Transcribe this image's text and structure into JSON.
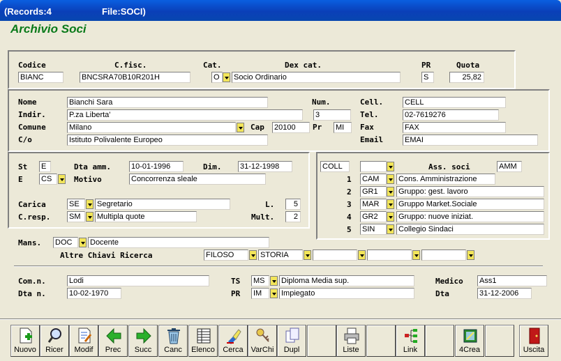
{
  "window": {
    "records": "(Records:4",
    "file": "File:SOCI)"
  },
  "app_title": "Archivio Soci",
  "labels": {
    "codice": "Codice",
    "cfisc": "C.fisc.",
    "cat": "Cat.",
    "dexcat": "Dex cat.",
    "pr": "PR",
    "quota": "Quota",
    "nome": "Nome",
    "indir": "Indir.",
    "comune": "Comune",
    "co": "C/o",
    "num": "Num.",
    "cap": "Cap",
    "pr2": "Pr",
    "cell": "Cell.",
    "tel": "Tel.",
    "fax": "Fax",
    "email": "Email",
    "st": "St",
    "dtaamm": "Dta amm.",
    "dim": "Dim.",
    "e": "E",
    "motivo": "Motivo",
    "carica": "Carica",
    "l": "L.",
    "cresp": "C.resp.",
    "mult": "Mult.",
    "asssoci": "Ass. soci",
    "mans": "Mans.",
    "altre": "Altre Chiavi Ricerca",
    "comn": "Com.n.",
    "dtan": "Dta n.",
    "ts": "TS",
    "pr3": "PR",
    "medico": "Medico",
    "dta": "Dta"
  },
  "fields": {
    "codice": "BIANC",
    "cfisc": "BNCSRA70B10R201H",
    "cat_code": "O",
    "cat_desc": "Socio Ordinario",
    "pr": "S",
    "quota": "25,82",
    "nome": "Bianchi Sara",
    "indir": "P.za Liberta'",
    "comune": "Milano",
    "co": "Istituto Polivalente Europeo",
    "num": "3",
    "cap": "20100",
    "prov": "MI",
    "cell": "CELL",
    "tel": "02-7619276",
    "fax": "FAX",
    "email": "EMAI",
    "st": "E",
    "dtaamm": "10-01-1996",
    "dim": "31-12-1998",
    "e_code": "CS",
    "motivo": "Concorrenza sleale",
    "carica_code": "SE",
    "carica_desc": "Segretario",
    "l": "5",
    "cresp_code": "SM",
    "cresp_desc": "Multipla quote",
    "mult": "2",
    "coll": "COLL",
    "ass_code": "AMM",
    "mans_code": "DOC",
    "mans_desc": "Docente",
    "chiave1": "FILOSO",
    "chiave2": "STORIA",
    "comn": "Lodi",
    "dtan": "10-02-1970",
    "ts_code": "MS",
    "ts_desc": "Diploma Media sup.",
    "pr_code": "IM",
    "pr_desc": "Impiegato",
    "medico": "Ass1",
    "dta": "31-12-2006"
  },
  "assoc": [
    {
      "n": "1",
      "code": "CAM",
      "desc": "Cons. Amministrazione"
    },
    {
      "n": "2",
      "code": "GR1",
      "desc": "Gruppo: gest. lavoro"
    },
    {
      "n": "3",
      "code": "MAR",
      "desc": "Gruppo Market.Sociale"
    },
    {
      "n": "4",
      "code": "GR2",
      "desc": "Gruppo: nuove iniziat."
    },
    {
      "n": "5",
      "code": "SIN",
      "desc": "Collegio Sindaci"
    }
  ],
  "toolbar": [
    {
      "label": "Nuovo",
      "icon": "new-doc-icon"
    },
    {
      "label": "Ricer",
      "icon": "magnifier-icon"
    },
    {
      "label": "Modif",
      "icon": "edit-doc-icon"
    },
    {
      "label": "Prec",
      "icon": "arrow-left-icon"
    },
    {
      "label": "Succ",
      "icon": "arrow-right-icon"
    },
    {
      "label": "Canc",
      "icon": "trash-icon"
    },
    {
      "label": "Elenco",
      "icon": "list-icon"
    },
    {
      "label": "Cerca",
      "icon": "search-highlight-icon"
    },
    {
      "label": "VarChi",
      "icon": "key-icon"
    },
    {
      "label": "Dupl",
      "icon": "copy-icon"
    },
    {
      "label": "",
      "icon": ""
    },
    {
      "label": "Liste",
      "icon": "printer-icon"
    },
    {
      "label": "",
      "icon": ""
    },
    {
      "label": "Link",
      "icon": "link-tree-icon"
    },
    {
      "label": "",
      "icon": ""
    },
    {
      "label": "4Crea",
      "icon": "create-icon"
    },
    {
      "label": "",
      "icon": ""
    },
    {
      "label": "Uscita",
      "icon": "exit-door-icon"
    }
  ],
  "colors": {
    "titlebar": "#0a4fd0",
    "app_title": "#0a7a1a",
    "dropdown": "#f2e55a",
    "background": "#ece9d8"
  }
}
